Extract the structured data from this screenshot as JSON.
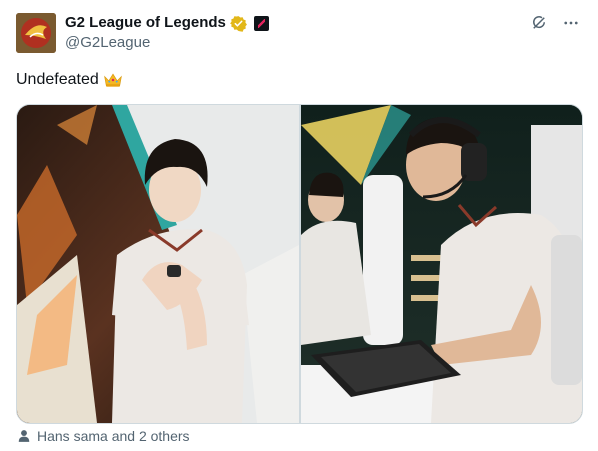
{
  "author": {
    "display_name": "G2 League of Legends",
    "handle": "@G2League"
  },
  "tweet": {
    "text": "Undefeated"
  },
  "media": {
    "photos": [
      {
        "subject": "player-posing-with-watch"
      },
      {
        "subject": "player-at-gaming-setup"
      }
    ]
  },
  "social_context": {
    "text": "Hans sama and 2 others"
  },
  "icons": {
    "verified": "verified-gold-badge-icon",
    "affiliate": "g2-affiliate-badge-icon",
    "grok": "grok-icon",
    "more": "more-options-icon",
    "crown": "crown-emoji-icon",
    "person": "person-icon"
  },
  "colors": {
    "verified_gold": "#e2b719",
    "secondary_text": "#536471",
    "border": "#cfd9de"
  }
}
